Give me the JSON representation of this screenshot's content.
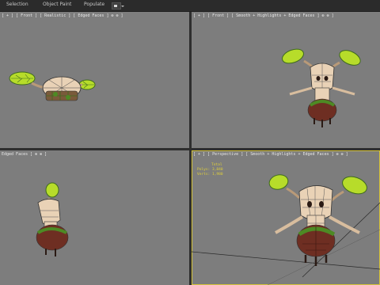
{
  "toolbar": {
    "items": [
      "Selection",
      "Object Paint",
      "Populate"
    ],
    "display_icon": "viewport-display-icon"
  },
  "viewports": {
    "top_left": {
      "label": "[ + ] [ Front ] [ Realistic ] [ Edged Faces ] ⊕ ⊗ ]"
    },
    "top_right": {
      "label": "[ + ] [ Front ] [ Smooth + Highlights + Edged Faces ] ⊕ ⊗ ]"
    },
    "bottom_left": {
      "label": "Edged Faces ] ⊕ ⊗ ]"
    },
    "bottom_right": {
      "label": "[ + ] [ Perspective ] [ Smooth + Highlights + Edged Faces ] ⊕ ⊗ ]",
      "stats": {
        "header": "Total",
        "polys_label": "Polys:",
        "polys": "3,840",
        "verts_label": "Verts:",
        "verts": "1,980"
      }
    }
  },
  "colors": {
    "viewport_bg": "#7d7d7d",
    "active_border": "#d4c23a",
    "stats_text": "#e0d03a",
    "bark": "#e9d2b6",
    "leaf": "#b7dc2a",
    "moss": "#3f6a1f",
    "root": "#6e2e22"
  }
}
